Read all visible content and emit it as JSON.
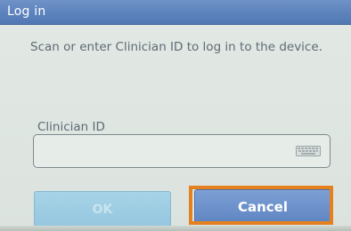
{
  "dialog": {
    "title": "Log in",
    "instructions": "Scan or enter Clinician ID to log in to the device."
  },
  "form": {
    "clinician_id_label": "Clinician ID",
    "clinician_id_value": "",
    "keyboard_icon": "keyboard-icon"
  },
  "buttons": {
    "ok_label": "OK",
    "ok_enabled": false,
    "cancel_label": "Cancel"
  },
  "colors": {
    "titlebar": "#5d83bd",
    "background": "#dfe6e2",
    "ok_disabled": "#9ccbe1",
    "cancel": "#6b90c9",
    "highlight": "#e5801e"
  }
}
